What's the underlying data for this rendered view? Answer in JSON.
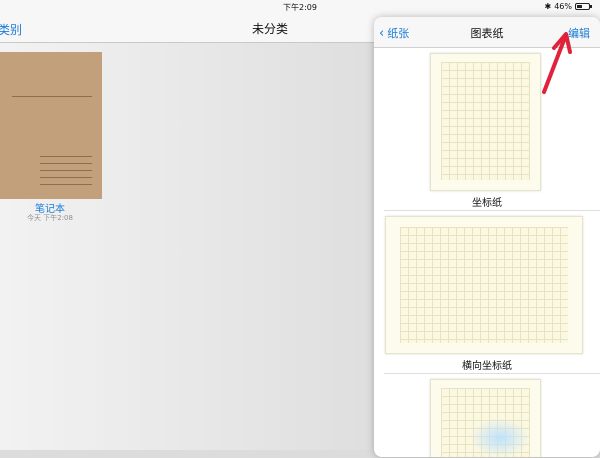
{
  "status_bar": {
    "time": "下午2:09",
    "battery_pct_text": "46%",
    "battery_level": 0.46
  },
  "nav": {
    "back_label": "类别",
    "title": "未分类"
  },
  "notebook": {
    "title": "笔记本",
    "date": "今天 下午2:08"
  },
  "panel": {
    "back_label": "纸张",
    "title": "图表纸",
    "edit_label": "编辑",
    "papers": [
      {
        "label": "坐标纸"
      },
      {
        "label": "横向坐标纸"
      },
      {
        "label": ""
      }
    ]
  },
  "colors": {
    "accent": "#1a7bd6",
    "annotation_arrow": "#e0223b",
    "notebook_cover": "#c3a07c"
  }
}
